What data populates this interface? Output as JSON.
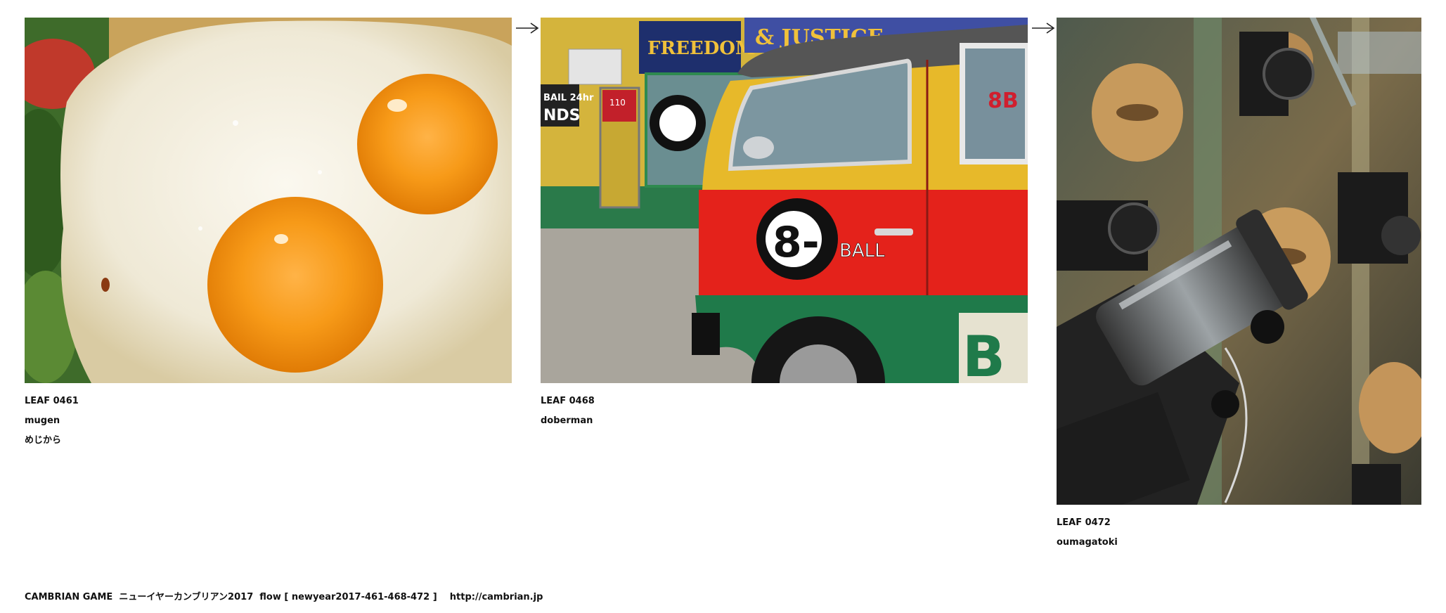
{
  "leaves": [
    {
      "code": "LEAF 0461",
      "author": "mugen",
      "title": "めじから"
    },
    {
      "code": "LEAF 0468",
      "author": "doberman"
    },
    {
      "code": "LEAF 0472",
      "author": "oumagatoki"
    }
  ],
  "photo_signs": {
    "freedom": "FREEDOM",
    "justice": "& JUSTICE",
    "bonds": "BONDS",
    "bail": "BAIL 24hr",
    "bail_bonds": "NDS",
    "door_number": "110",
    "eight": "8-",
    "ball": "BALL",
    "window_8b": "8B",
    "b_letter": "B"
  },
  "footer": {
    "text": "CAMBRIAN GAME  ニューイヤーカンブリアン2017  flow [ newyear2017-461-468-472 ]    http://cambrian.jp"
  },
  "icons": {
    "arrow": "right-arrow-icon"
  }
}
